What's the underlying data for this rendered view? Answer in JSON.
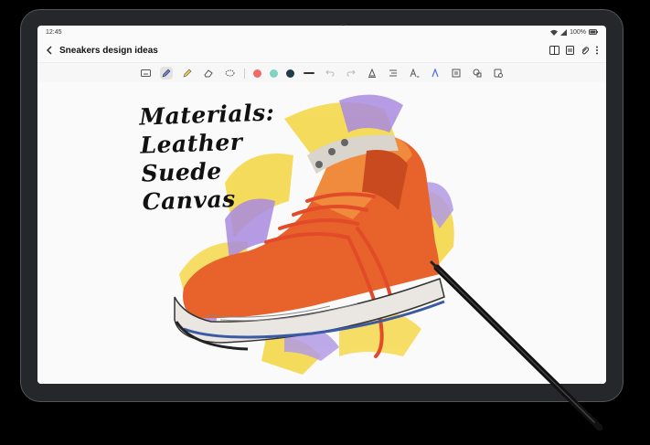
{
  "status": {
    "time": "12:45",
    "battery": "100%"
  },
  "note": {
    "title": "Sneakers design ideas",
    "handwriting": [
      "Materials:",
      "Leather",
      "Suede",
      "Canvas"
    ]
  },
  "toolbar": {
    "colors": [
      "#f06a6a",
      "#7fd3c3",
      "#1f3a4a"
    ]
  },
  "icons": {
    "back": "chevron-left-icon",
    "book": "book-icon",
    "page": "page-icon",
    "attach": "paperclip-icon",
    "more": "more-icon"
  }
}
